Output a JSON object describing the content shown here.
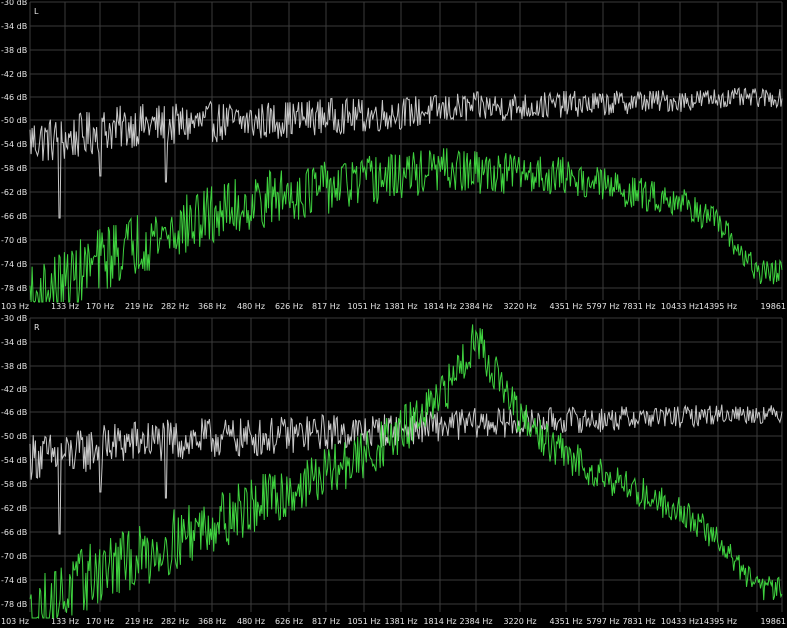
{
  "chart_data": [
    {
      "type": "line",
      "channel": "L",
      "x_tick_labels": [
        "103 Hz",
        "133 Hz",
        "170 Hz",
        "219 Hz",
        "282 Hz",
        "368 Hz",
        "480 Hz",
        "626 Hz",
        "817 Hz",
        "1051 Hz",
        "1381 Hz",
        "1814 Hz",
        "2384 Hz",
        "3220 Hz",
        "4351 Hz",
        "5797 Hz",
        "7831 Hz",
        "10433 Hz",
        "14395 Hz",
        "19861"
      ],
      "y_tick_labels": [
        "-30 dB",
        "-34 dB",
        "-38 dB",
        "-42 dB",
        "-46 dB",
        "-50 dB",
        "-54 dB",
        "-58 dB",
        "-62 dB",
        "-66 dB",
        "-70 dB",
        "-74 dB",
        "-78 dB"
      ],
      "ylim": [
        -80,
        -30
      ],
      "xscale": "log",
      "grid": true,
      "series": [
        {
          "color": "#c8c8c8",
          "envelope": {
            "x": [
              103,
              133,
              170,
              219,
              282,
              368,
              480,
              626,
              817,
              1051,
              1381,
              1814,
              2384,
              3220,
              4351,
              5797,
              7831,
              10433,
              14395,
              19861
            ],
            "y": [
              -53,
              -53,
              -51.5,
              -50.5,
              -50.5,
              -50,
              -50,
              -49.5,
              -49,
              -49,
              -48.5,
              -48,
              -47.5,
              -47.5,
              -47,
              -47,
              -46.5,
              -46.5,
              -46,
              -46
            ]
          },
          "jitter_db": [
            4,
            1.5
          ],
          "dips": [
            {
              "x": 128,
              "y": -66
            },
            {
              "x": 170,
              "y": -59
            },
            {
              "x": 265,
              "y": -60
            }
          ]
        },
        {
          "color": "#3fd23f",
          "envelope": {
            "x": [
              103,
              133,
              170,
              219,
              282,
              368,
              480,
              626,
              817,
              1051,
              1381,
              1814,
              2384,
              3220,
              4351,
              5797,
              7831,
              10433,
              14395,
              19861
            ],
            "y": [
              -80,
              -77,
              -73,
              -70,
              -68,
              -65.5,
              -63.5,
              -62,
              -61,
              -60,
              -59,
              -58,
              -58.5,
              -58.5,
              -59,
              -60.5,
              -62,
              -63,
              -67,
              -75
            ]
          },
          "jitter_db": [
            6,
            2
          ]
        }
      ]
    },
    {
      "type": "line",
      "channel": "R",
      "x_tick_labels": [
        "103 Hz",
        "133 Hz",
        "170 Hz",
        "219 Hz",
        "282 Hz",
        "368 Hz",
        "480 Hz",
        "626 Hz",
        "817 Hz",
        "1051 Hz",
        "1381 Hz",
        "1814 Hz",
        "2384 Hz",
        "3220 Hz",
        "4351 Hz",
        "5797 Hz",
        "7831 Hz",
        "10433 Hz",
        "14395 Hz",
        "19861"
      ],
      "y_tick_labels": [
        "-30 dB",
        "-34 dB",
        "-38 dB",
        "-42 dB",
        "-46 dB",
        "-50 dB",
        "-54 dB",
        "-58 dB",
        "-62 dB",
        "-66 dB",
        "-70 dB",
        "-74 dB",
        "-78 dB"
      ],
      "ylim": [
        -80,
        -30
      ],
      "xscale": "log",
      "grid": true,
      "series": [
        {
          "color": "#c8c8c8",
          "envelope": {
            "x": [
              103,
              133,
              170,
              219,
              282,
              368,
              480,
              626,
              817,
              1051,
              1381,
              1814,
              2384,
              3220,
              4351,
              5797,
              7831,
              10433,
              14395,
              19861
            ],
            "y": [
              -53,
              -53,
              -51.5,
              -50.5,
              -50.5,
              -50,
              -50,
              -49.5,
              -49,
              -49,
              -48.5,
              -48,
              -47.5,
              -47.5,
              -47,
              -47,
              -46.5,
              -46.5,
              -46,
              -46
            ]
          },
          "jitter_db": [
            4,
            1.5
          ],
          "dips": [
            {
              "x": 128,
              "y": -66
            },
            {
              "x": 170,
              "y": -59
            },
            {
              "x": 265,
              "y": -60
            }
          ]
        },
        {
          "color": "#3fd23f",
          "envelope": {
            "x": [
              103,
              133,
              170,
              219,
              282,
              368,
              480,
              626,
              817,
              1051,
              1381,
              1814,
              2384,
              3220,
              4351,
              5797,
              7831,
              10433,
              14395,
              19861
            ],
            "y": [
              -80,
              -76,
              -72,
              -70,
              -67,
              -64,
              -61.5,
              -59,
              -56,
              -53,
              -49,
              -44,
              -33,
              -47,
              -53,
              -56,
              -59,
              -62,
              -67,
              -75
            ]
          },
          "jitter_db": [
            6,
            2
          ],
          "peak": {
            "x": 2050,
            "y": -31
          }
        }
      ]
    }
  ]
}
